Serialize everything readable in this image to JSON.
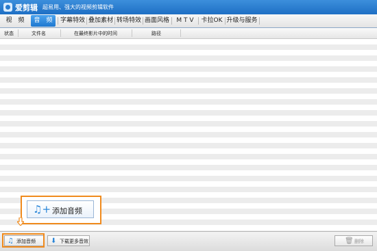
{
  "app": {
    "name": "爱剪辑",
    "slogan": "超易用、强大的视频剪辑软件"
  },
  "tabs": [
    {
      "label": "视　频"
    },
    {
      "label": "音　频"
    },
    {
      "label": "字幕特效"
    },
    {
      "label": "叠加素材"
    },
    {
      "label": "转场特效"
    },
    {
      "label": "画面风格"
    },
    {
      "label": "M T V"
    },
    {
      "label": "卡拉OK"
    },
    {
      "label": "升级与服务"
    }
  ],
  "active_tab": "音　频",
  "table": {
    "columns": [
      "状态",
      "文件名",
      "在最终影片中的时间",
      "路径"
    ],
    "rows": []
  },
  "callout": {
    "label": "添加音频",
    "icon": "music-add-icon"
  },
  "bottom": {
    "add_label": "添加音频",
    "download_label": "下载更多音效",
    "delete_label": "删除"
  },
  "colors": {
    "title_bar": "#1e6fc4",
    "active_tab": "#2a86d8",
    "highlight": "#f08a1c"
  }
}
